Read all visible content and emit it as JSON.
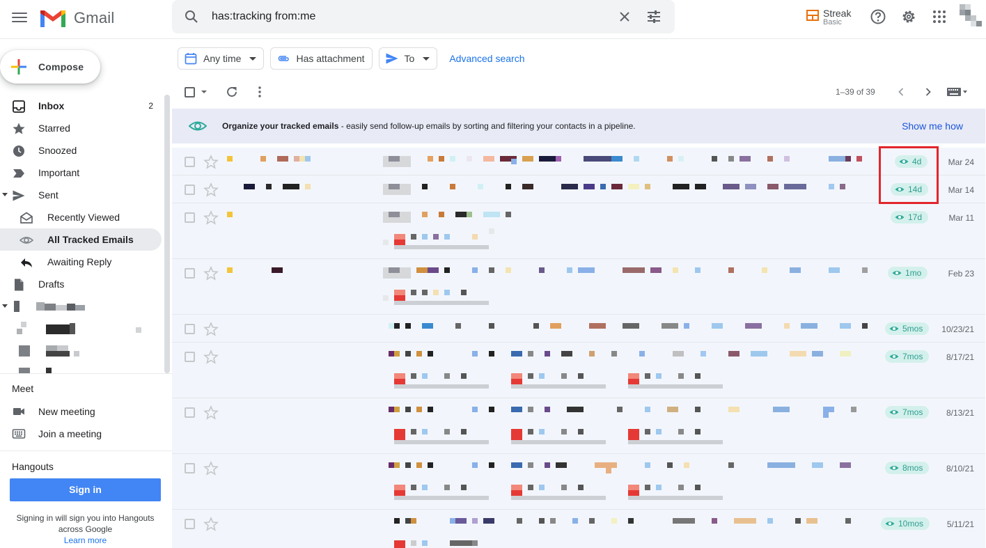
{
  "app": {
    "name": "Gmail",
    "search_query": "has:tracking from:me",
    "streak_name": "Streak",
    "streak_plan": "Basic"
  },
  "compose": {
    "label": "Compose"
  },
  "nav": [
    {
      "label": "Inbox",
      "count": "2",
      "icon": "inbox-icon",
      "bold": true
    },
    {
      "label": "Starred",
      "icon": "star-icon"
    },
    {
      "label": "Snoozed",
      "icon": "clock-icon"
    },
    {
      "label": "Important",
      "icon": "important-icon"
    },
    {
      "label": "Sent",
      "icon": "send-icon"
    },
    {
      "label": "Recently Viewed",
      "icon": "envelope-open-icon",
      "sub": true
    },
    {
      "label": "All Tracked Emails",
      "icon": "eye-icon",
      "sub": true,
      "active": true
    },
    {
      "label": "Awaiting Reply",
      "icon": "reply-icon",
      "sub": true
    },
    {
      "label": "Drafts",
      "icon": "draft-icon"
    }
  ],
  "meet": {
    "title": "Meet",
    "items": [
      {
        "label": "New meeting",
        "icon": "video-icon"
      },
      {
        "label": "Join a meeting",
        "icon": "keyboard-icon"
      }
    ]
  },
  "hangouts": {
    "title": "Hangouts",
    "sign_in": "Sign in",
    "note": "Signing in will sign you into Hangouts across Google",
    "learn_more": "Learn more"
  },
  "filters": {
    "any_time": "Any time",
    "has_attachment": "Has attachment",
    "to": "To",
    "advanced": "Advanced search"
  },
  "toolbar": {
    "range": "1–39 of 39"
  },
  "banner": {
    "bold": "Organize your tracked emails",
    "text": " - easily send follow-up emails by sorting and filtering your contacts in a pipeline.",
    "link": "Show me how"
  },
  "rows": [
    {
      "tag": "4d",
      "date": "Mar 24"
    },
    {
      "tag": "14d",
      "date": "Mar 14"
    },
    {
      "tag": "17d",
      "date": "Mar 11"
    },
    {
      "tag": "1mo",
      "date": "Feb 23"
    },
    {
      "tag": "5mos",
      "date": "10/23/21"
    },
    {
      "tag": "7mos",
      "date": "8/17/21"
    },
    {
      "tag": "7mos",
      "date": "8/13/21"
    },
    {
      "tag": "8mos",
      "date": "8/10/21"
    },
    {
      "tag": "10mos",
      "date": "5/11/21"
    }
  ],
  "colors": {
    "accent": "#1a73e8",
    "tracked_tag_bg": "#d4f0ec",
    "tracked_tag_fg": "#2e9e8e",
    "highlight": "#e3252c"
  }
}
